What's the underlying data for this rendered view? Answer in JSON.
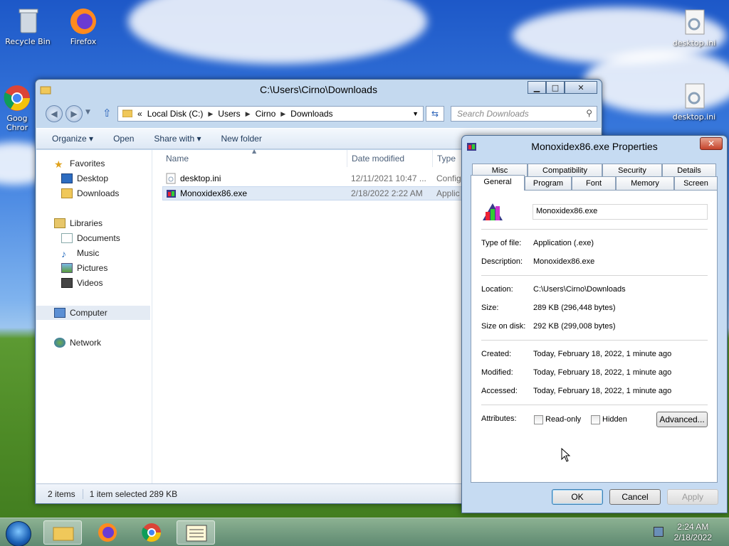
{
  "desktop": {
    "icons": [
      {
        "label": "Recycle Bin"
      },
      {
        "label": "Firefox"
      },
      {
        "label": "Goog Chror"
      },
      {
        "label": "desktop.ini"
      },
      {
        "label": "desktop.ini"
      }
    ]
  },
  "explorer": {
    "title": "C:\\Users\\Cirno\\Downloads",
    "caption": {
      "minimize": "▁",
      "maximize": "□",
      "close": "✕"
    },
    "address": {
      "prefix": "«",
      "crumbs": [
        "Local Disk (C:)",
        "Users",
        "Cirno",
        "Downloads"
      ]
    },
    "search_placeholder": "Search Downloads",
    "toolbar": {
      "organize": "Organize ▾",
      "open": "Open",
      "share": "Share with ▾",
      "new_folder": "New folder"
    },
    "nav": {
      "favorites": "Favorites",
      "desktop": "Desktop",
      "downloads": "Downloads",
      "libraries": "Libraries",
      "documents": "Documents",
      "music": "Music",
      "pictures": "Pictures",
      "videos": "Videos",
      "computer": "Computer",
      "network": "Network"
    },
    "columns": {
      "name": "Name",
      "date": "Date modified",
      "type": "Type"
    },
    "files": [
      {
        "name": "desktop.ini",
        "date": "12/11/2021 10:47 ...",
        "type": "Config"
      },
      {
        "name": "Monoxidex86.exe",
        "date": "2/18/2022 2:22 AM",
        "type": "Applic"
      }
    ],
    "status": {
      "count": "2 items",
      "selected": "1 item selected  289 KB"
    }
  },
  "properties": {
    "title": "Monoxidex86.exe Properties",
    "close": "✕",
    "tabs_back": [
      "Misc",
      "Compatibility",
      "Security",
      "Details"
    ],
    "tabs_front": [
      "General",
      "Program",
      "Font",
      "Memory",
      "Screen"
    ],
    "filename": "Monoxidex86.exe",
    "fields": {
      "type_label": "Type of file:",
      "type": "Application (.exe)",
      "desc_label": "Description:",
      "desc": "Monoxidex86.exe",
      "loc_label": "Location:",
      "loc": "C:\\Users\\Cirno\\Downloads",
      "size_label": "Size:",
      "size": "289 KB (296,448 bytes)",
      "disk_label": "Size on disk:",
      "disk": "292 KB (299,008 bytes)",
      "created_label": "Created:",
      "created": "Today, February 18, 2022, 1 minute ago",
      "modified_label": "Modified:",
      "modified": "Today, February 18, 2022, 1 minute ago",
      "accessed_label": "Accessed:",
      "accessed": "Today, February 18, 2022, 1 minute ago",
      "attr_label": "Attributes:",
      "readonly": "Read-only",
      "hidden": "Hidden"
    },
    "buttons": {
      "advanced": "Advanced...",
      "ok": "OK",
      "cancel": "Cancel",
      "apply": "Apply"
    }
  },
  "taskbar": {
    "time": "2:24 AM",
    "date": "2/18/2022"
  }
}
